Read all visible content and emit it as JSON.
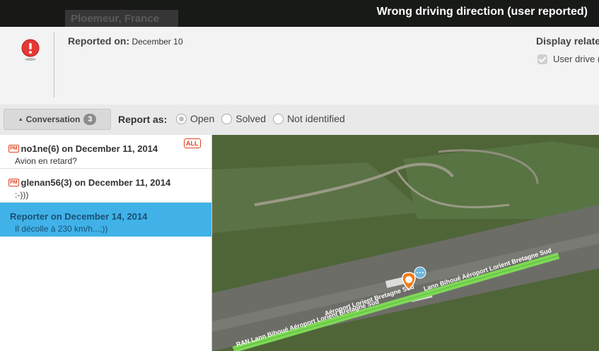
{
  "header": {
    "city": "Ploemeur, France",
    "title": "Wrong driving direction (user reported)"
  },
  "info": {
    "reported_label": "Reported on:",
    "reported_date": "December 10",
    "display_related_label": "Display relate",
    "user_drive_label": "User drive ("
  },
  "report_bar": {
    "conversation_label": "Conversation",
    "conversation_count": "3",
    "report_as_label": "Report as:",
    "options": [
      "Open",
      "Solved",
      "Not identified"
    ],
    "selected": "Open"
  },
  "conversation": [
    {
      "tag": "PM",
      "author": "no1ne(6) on December 11, 2014",
      "text": "Avion en retard?",
      "badge": "ALL"
    },
    {
      "tag": "PM",
      "author": "glenan56(3) on December 11, 2014",
      "text": ":-)))"
    },
    {
      "author": "Reporter on December 14, 2014",
      "text": "Il décolle à 230 km/h...;))"
    }
  ],
  "map": {
    "road_label_1": "Lann Bihoué Aéroport Lorient Bretagne Sud",
    "road_label_2": "Lann Bihoué Aéroport Lorient Bretagne Sud",
    "road_label_3": "Aéroport Lorient Bretagne Sud",
    "road_label_4": "RAN Lann Bihoué Aéroport Lorient Bretagne Sud",
    "highlight_color": "#7ed957"
  }
}
